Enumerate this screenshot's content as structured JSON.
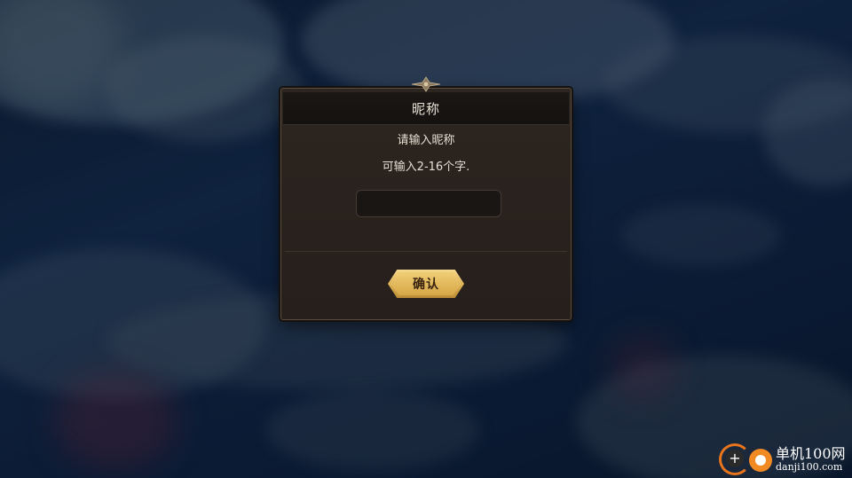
{
  "dialog": {
    "title": "昵称",
    "prompt": "请输入昵称",
    "constraint": "可输入2-16个字.",
    "input_value": "",
    "confirm_label": "确认"
  },
  "watermark": {
    "name": "单机100网",
    "domain": "danji100.com"
  },
  "colors": {
    "button_gold": "#dcb055",
    "dialog_bg": "#2a231e",
    "text": "#e6dfd3"
  }
}
